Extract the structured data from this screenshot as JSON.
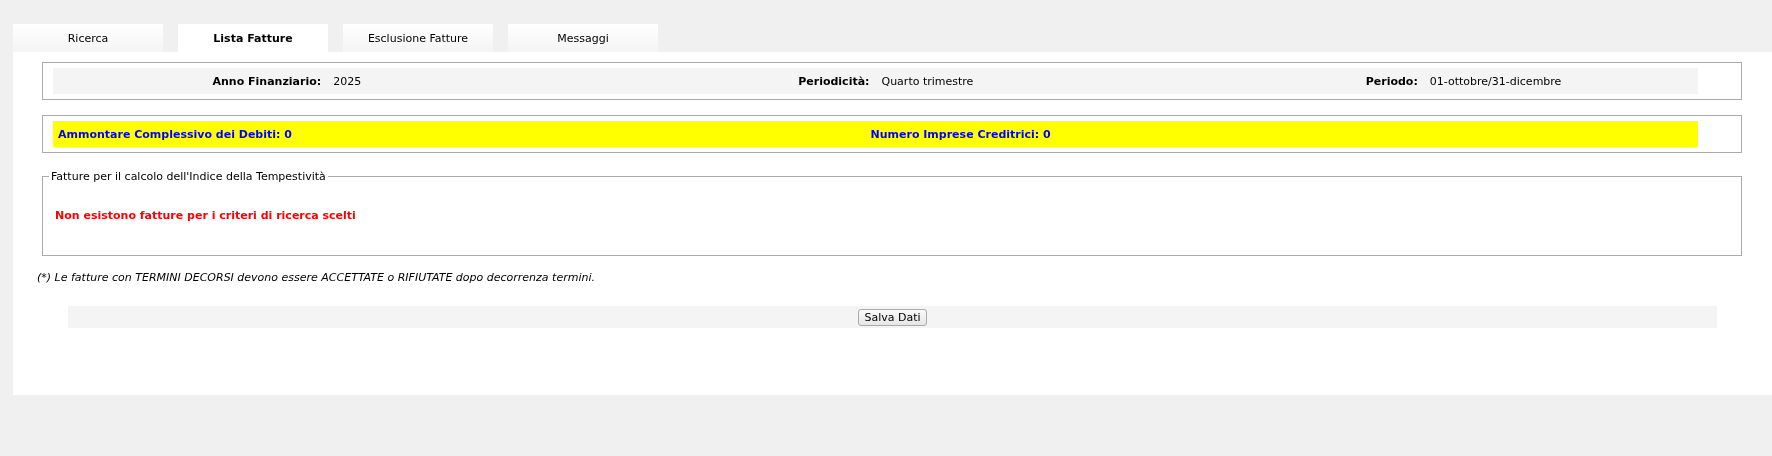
{
  "tabs": [
    {
      "label": "Ricerca",
      "selected": false
    },
    {
      "label": "Lista Fatture",
      "selected": true
    },
    {
      "label": "Esclusione Fatture",
      "selected": false
    },
    {
      "label": "Messaggi",
      "selected": false
    }
  ],
  "info": [
    {
      "label": "Anno Finanziario:",
      "value": "2025"
    },
    {
      "label": "Periodicità:",
      "value": "Quarto trimestre"
    },
    {
      "label": "Periodo:",
      "value": "01-ottobre/31-dicembre"
    }
  ],
  "totals": [
    "Ammontare Complessivo dei Debiti: 0",
    "Numero Imprese Creditrici: 0"
  ],
  "invoices": {
    "legend": "Fatture per il calcolo dell'Indice della Tempestività",
    "message": "Non esistono fatture per i criteri di ricerca scelti"
  },
  "note": "(*) Le fatture con TERMINI DECORSI devono essere ACCETTATE o RIFIUTATE dopo decorrenza termini.",
  "buttons": [
    "Salva Dati"
  ]
}
